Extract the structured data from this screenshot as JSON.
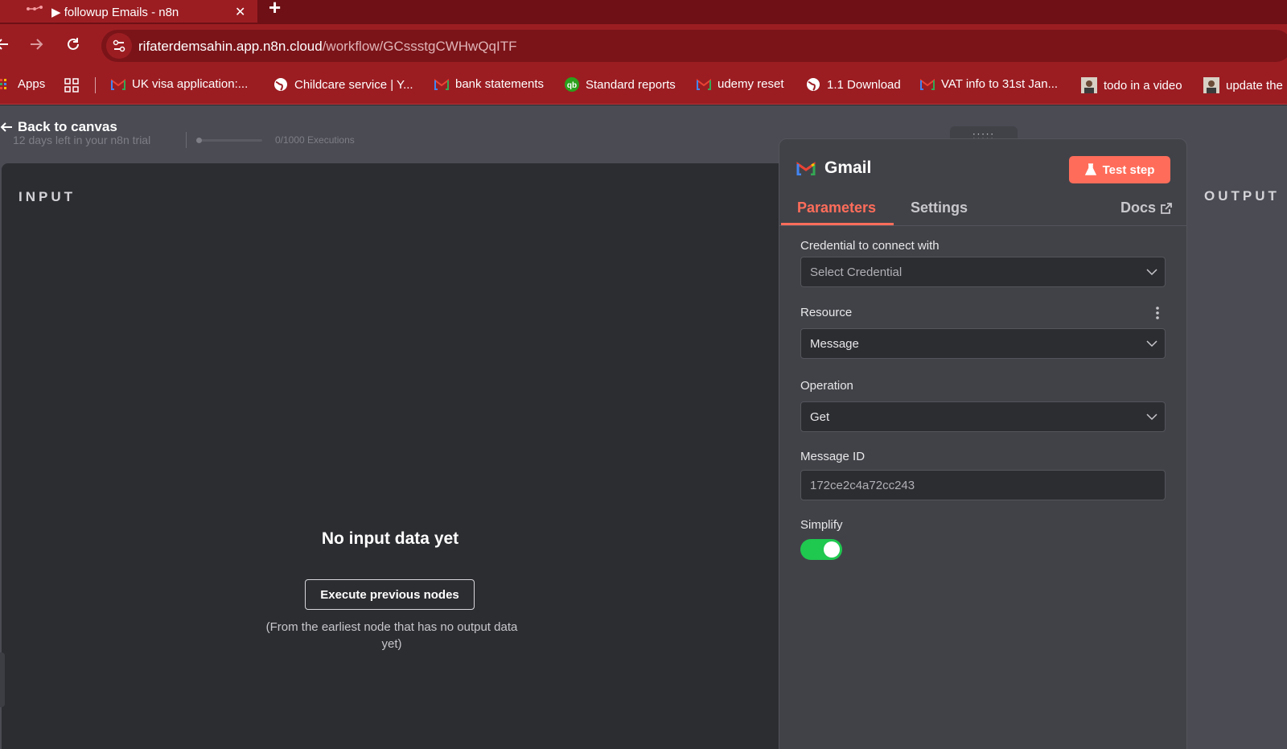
{
  "browser": {
    "tab_title": "▶ followup Emails - n8n",
    "new_tab": "+",
    "close": "✕",
    "url_host": "rifaterdemsahin.app.n8n.cloud",
    "url_path": "/workflow/GCssstgCWHwQqITF"
  },
  "bookmarks": [
    {
      "label": "Apps",
      "icon": "apps-icon"
    },
    {
      "label": "UK visa application:...",
      "icon": "gmail-icon"
    },
    {
      "label": "Childcare service | Y...",
      "icon": "globe-icon"
    },
    {
      "label": "bank statements",
      "icon": "gmail-icon"
    },
    {
      "label": "Standard reports",
      "icon": "quickbooks-icon"
    },
    {
      "label": "udemy reset",
      "icon": "gmail-icon"
    },
    {
      "label": "1.1 Download",
      "icon": "globe-icon"
    },
    {
      "label": "VAT info to 31st Jan...",
      "icon": "gmail-icon"
    },
    {
      "label": "todo in a video",
      "icon": "avatar-icon"
    },
    {
      "label": "update the",
      "icon": "avatar-icon"
    }
  ],
  "app": {
    "back_label": "Back to canvas",
    "trial_text": "12 days left in your n8n trial",
    "executions_text": "0/1000 Executions",
    "input_label": "INPUT",
    "output_label": "OUTPUT",
    "no_input_title": "No input data yet",
    "execute_button": "Execute previous nodes",
    "execute_hint": "(From the earliest node that has no output data yet)"
  },
  "node": {
    "title": "Gmail",
    "test_button": "Test step",
    "tabs": [
      "Parameters",
      "Settings"
    ],
    "docs_label": "Docs",
    "accent_color": "#ff6d5a",
    "fields": {
      "credential_label": "Credential to connect with",
      "credential_placeholder": "Select Credential",
      "resource_label": "Resource",
      "resource_value": "Message",
      "operation_label": "Operation",
      "operation_value": "Get",
      "message_id_label": "Message ID",
      "message_id_value": "172ce2c4a72cc243",
      "simplify_label": "Simplify",
      "simplify_on": true
    }
  }
}
